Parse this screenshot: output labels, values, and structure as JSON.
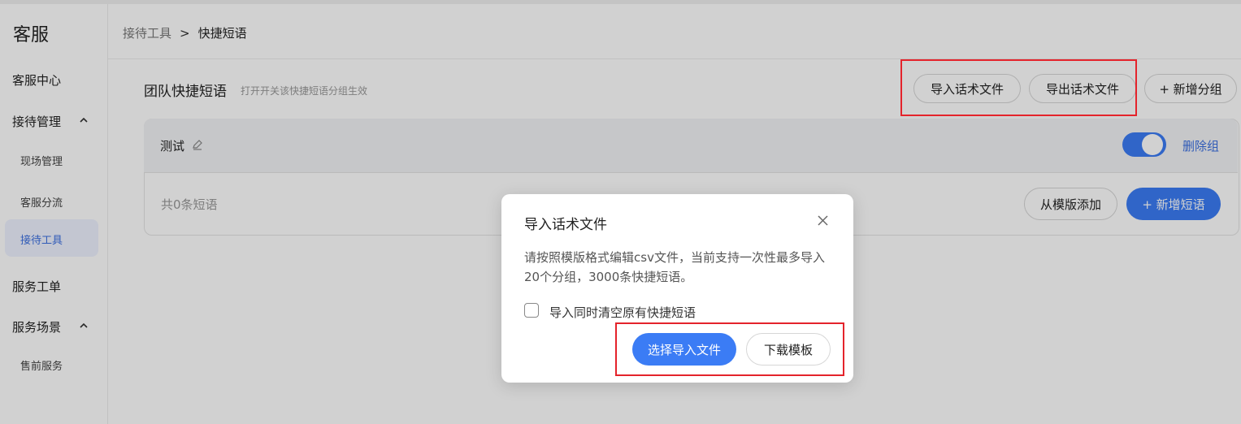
{
  "sidebar": {
    "title": "客服",
    "items": {
      "service_center": "客服中心",
      "reception_mgmt": "接待管理",
      "onsite_mgmt": "现场管理",
      "service_routing": "客服分流",
      "reception_tools": "接待工具",
      "service_ticket": "服务工单",
      "service_scene": "服务场景",
      "presale_service": "售前服务"
    },
    "caret_icon": "chevron-up-icon"
  },
  "breadcrumb": {
    "parent": "接待工具",
    "separator": ">",
    "current": "快捷短语"
  },
  "main": {
    "team_title": "团队快捷短语",
    "team_desc": "打开开关该快捷短语分组生效",
    "import_button": "导入话术文件",
    "export_button": "导出话术文件",
    "add_group_button": "+ 新增分组",
    "group": {
      "name": "测试",
      "enabled": true,
      "delete_label": "删除组",
      "count_text": "共0条短语",
      "add_from_template": "从模版添加",
      "add_phrase": "+ 新增短语"
    }
  },
  "modal": {
    "title": "导入话术文件",
    "description": "请按照模版格式编辑csv文件，当前支持一次性最多导入20个分组，3000条快捷短语。",
    "checkbox_label": "导入同时清空原有快捷短语",
    "checkbox_checked": false,
    "choose_file_button": "选择导入文件",
    "download_template_button": "下载模板"
  },
  "colors": {
    "primary": "#3b7cf5",
    "link": "#3b6fe0",
    "highlight_red": "#e4232b"
  }
}
